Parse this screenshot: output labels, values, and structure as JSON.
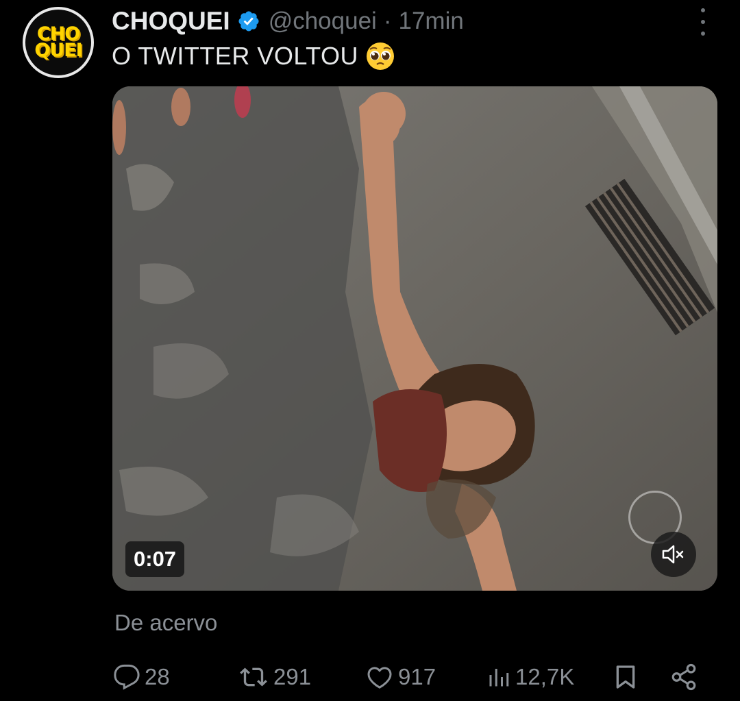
{
  "account": {
    "name": "CHOQUEI",
    "handle": "@choquei",
    "separator": "·",
    "time": "17min",
    "avatar_text_top": "CHO",
    "avatar_text_bottom": "QUEI",
    "verified_icon": "verified-badge-icon"
  },
  "tweet": {
    "text": "O TWITTER VOLTOU",
    "emoji": "pleading-face-emoji"
  },
  "media": {
    "duration": "0:07",
    "mute_icon": "speaker-muted-icon"
  },
  "source_label": "De acervo",
  "actions": {
    "replies": "28",
    "retweets": "291",
    "likes": "917",
    "views": "12,7K"
  },
  "colors": {
    "background": "#000000",
    "text": "#e7e9ea",
    "muted": "#71767b",
    "verified": "#1d9bf0",
    "brand": "#ffd400"
  }
}
